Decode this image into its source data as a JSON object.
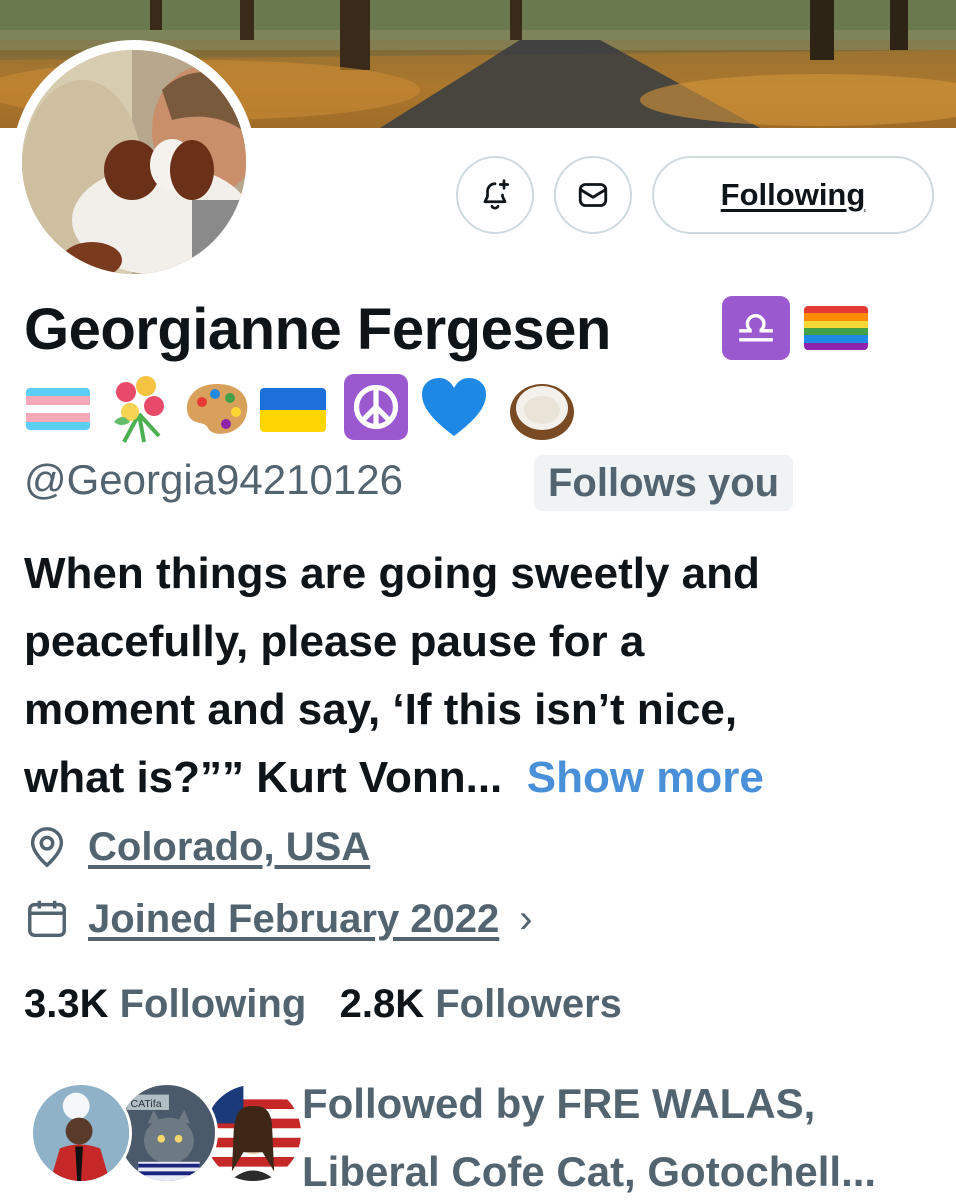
{
  "profile": {
    "display_name": "Georgianne Fergesen",
    "handle": "@Georgia94210126",
    "follows_you_badge": "Follows you",
    "bio_lines": [
      "When things are going sweetly and",
      "peacefully, please pause for a",
      "moment and say, ‘If this isn’t nice,",
      "what is?”” Kurt Vonn..."
    ],
    "show_more": "Show more",
    "location": "Colorado, USA",
    "joined": "Joined February 2022",
    "libra_symbol": "♎",
    "name_emojis": [
      "libra-badge",
      "rainbow-flag",
      "transgender-flag",
      "bouquet",
      "artist-palette",
      "ukraine-flag",
      "peace-symbol",
      "blue-heart",
      "coconut"
    ]
  },
  "actions": {
    "following_label": "Following",
    "notify_icon": "bell-plus-icon",
    "message_icon": "envelope-icon"
  },
  "stats": {
    "following_count": "3.3K",
    "following_label": "Following",
    "followers_count": "2.8K",
    "followers_label": "Followers"
  },
  "followed_by": {
    "line1": "Followed by FRE WALAS,",
    "line2": "Liberal Cofe Cat, Gotochell...",
    "avatar2_text": "CATifa"
  },
  "colors": {
    "link_blue": "#4a90d9",
    "secondary_text": "#536471",
    "primary_text": "#0f1419",
    "purple_badge": "#9b59d0"
  }
}
